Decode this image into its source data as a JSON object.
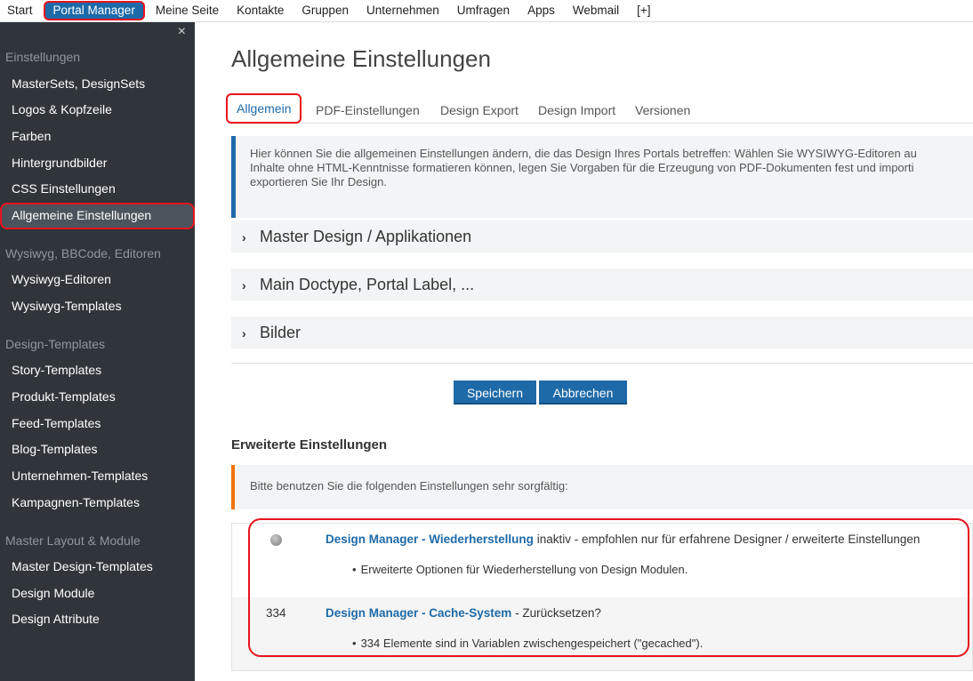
{
  "topnav": {
    "items": [
      "Start",
      "Portal Manager",
      "Meine Seite",
      "Kontakte",
      "Gruppen",
      "Unternehmen",
      "Umfragen",
      "Apps",
      "Webmail",
      "[+]"
    ]
  },
  "sidebar": {
    "close_glyph": "×",
    "groups": [
      {
        "label": "Einstellungen",
        "items": [
          "MasterSets, DesignSets",
          "Logos & Kopfzeile",
          "Farben",
          "Hintergrundbilder",
          "CSS Einstellungen",
          "Allgemeine Einstellungen"
        ]
      },
      {
        "label": "Wysiwyg, BBCode, Editoren",
        "items": [
          "Wysiwyg-Editoren",
          "Wysiwyg-Templates"
        ]
      },
      {
        "label": "Design-Templates",
        "items": [
          "Story-Templates",
          "Produkt-Templates",
          "Feed-Templates",
          "Blog-Templates",
          "Unternehmen-Templates",
          "Kampagnen-Templates"
        ]
      },
      {
        "label": "Master Layout & Module",
        "items": [
          "Master Design-Templates",
          "Design Module",
          "Design Attribute"
        ]
      }
    ]
  },
  "main": {
    "title": "Allgemeine Einstellungen",
    "tabs": [
      "Allgemein",
      "PDF-Einstellungen",
      "Design Export",
      "Design Import",
      "Versionen"
    ],
    "info_lines": [
      "Hier können Sie die allgemeinen Einstellungen ändern, die das Design Ihres Portals betreffen: Wählen Sie WYSIWYG-Editoren au",
      "Inhalte ohne HTML-Kenntnisse formatieren können, legen Sie Vorgaben für die Erzeugung von PDF-Dokumenten fest und importi",
      "exportieren Sie Ihr Design."
    ],
    "accordions": [
      "Master Design / Applikationen",
      "Main Doctype, Portal Label, ...",
      "Bilder"
    ],
    "save_label": "Speichern",
    "cancel_label": "Abbrechen",
    "advanced_heading": "Erweiterte Einstellungen",
    "warning": "Bitte benutzen Sie die folgenden Einstellungen sehr sorgfältig:",
    "options": [
      {
        "count": "",
        "link": "Design Manager - Wiederherstellung",
        "rest": " inaktiv - empfohlen nur für erfahrene Designer / erweiterte Einstellungen",
        "bullet": "Erweiterte Optionen für Wiederherstellung von Design Modulen."
      },
      {
        "count": "334",
        "link": "Design Manager - Cache-System",
        "rest": " - Zurücksetzen?",
        "bullet": "334 Elemente sind in Variablen zwischengespeichert (\"gecached\")."
      }
    ]
  },
  "colors": {
    "accent": "#1e6aa8",
    "highlight": "#e8141c",
    "sidebar_bg": "#2f353b",
    "warning": "#f0730d"
  }
}
